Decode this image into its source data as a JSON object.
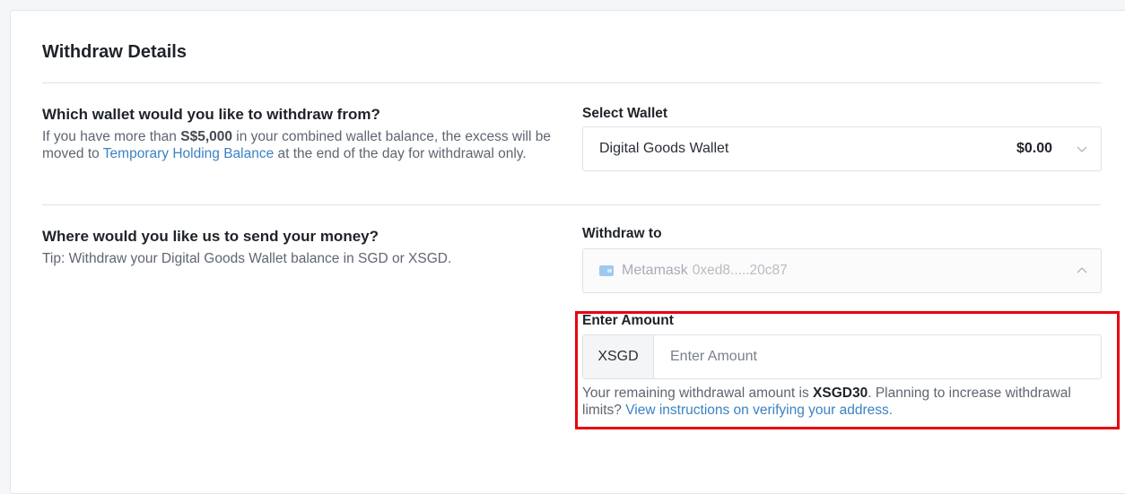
{
  "card": {
    "title": "Withdraw Details"
  },
  "wallet_section": {
    "question": "Which wallet would you like to withdraw from?",
    "desc_part1": "If you have more than ",
    "desc_bold": "S$5,000",
    "desc_part2": " in your combined wallet balance, the excess will be moved to ",
    "desc_link": "Temporary Holding Balance",
    "desc_part3": " at the end of the day for withdrawal only.",
    "field_label": "Select Wallet",
    "selected_wallet": "Digital Goods Wallet",
    "selected_balance": "$0.00",
    "chevron_icon": "chevron-down-icon"
  },
  "send_section": {
    "question": "Where would you like us to send your money?",
    "tip": "Tip: Withdraw your Digital Goods Wallet balance in SGD or XSGD.",
    "field_label": "Withdraw to",
    "wallet_name": "Metamask",
    "wallet_address": "0xed8.....20c87",
    "wallet_icon": "wallet-icon",
    "chevron_icon": "chevron-up-icon"
  },
  "amount_section": {
    "label": "Enter Amount",
    "currency": "XSGD",
    "value": "",
    "placeholder": "Enter Amount",
    "remain_part1": "Your remaining withdrawal amount is ",
    "remain_bold": "XSGD30",
    "remain_part2": ". Planning to increase withdrawal limits? ",
    "remain_link": "View instructions on verifying your address."
  },
  "colors": {
    "link": "#3b82c4",
    "highlight": "#e8000f"
  }
}
